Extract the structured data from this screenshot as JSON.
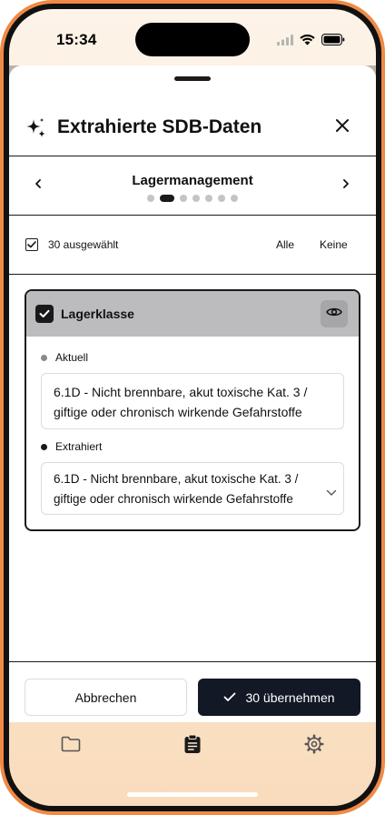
{
  "status_bar": {
    "time": "15:34"
  },
  "sheet": {
    "title": "Extrahierte SDB-Daten"
  },
  "section_nav": {
    "title": "Lagermanagement",
    "page_count": 7,
    "active_page": 2
  },
  "selection": {
    "count_label": "30 ausgewählt",
    "all_label": "Alle",
    "none_label": "Keine",
    "checked": true
  },
  "card": {
    "title": "Lagerklasse",
    "checked": true,
    "current": {
      "label": "Aktuell",
      "value_line1": "6.1D - Nicht brennbare, akut toxische Kat. 3 /",
      "value_line2": "giftige oder chronisch wirkende Gefahrstoffe"
    },
    "extracted": {
      "label": "Extrahiert",
      "value_line1": "6.1D - Nicht brennbare, akut toxische Kat. 3 /",
      "value_line2": "giftige oder chronisch wirkende Gefahrstoffe"
    }
  },
  "footer": {
    "cancel_label": "Abbrechen",
    "apply_label": "30 übernehmen"
  },
  "tabbar": {
    "items": [
      "folder-icon",
      "clipboard-icon",
      "gear-icon"
    ],
    "active": "clipboard-icon"
  },
  "colors": {
    "frame": "#f08a45",
    "primary_button": "#121826",
    "card_header": "#bcbcbf"
  }
}
